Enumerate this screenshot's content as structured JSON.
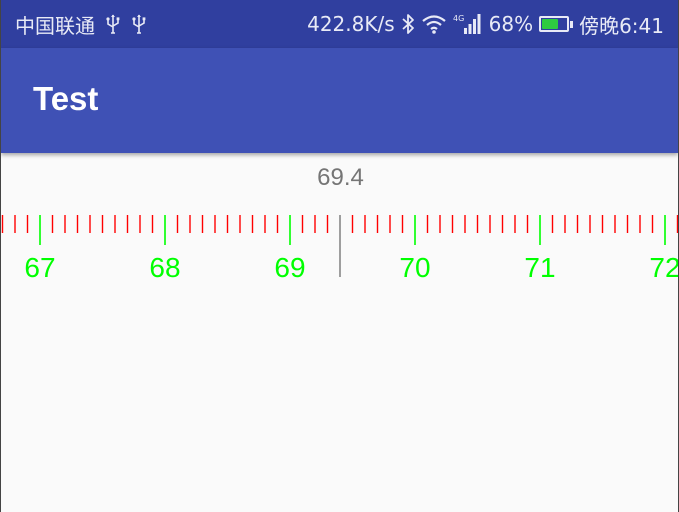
{
  "status_bar": {
    "carrier": "中国联通",
    "usb_icons": [
      "usb-icon",
      "usb-icon"
    ],
    "net_speed": "422.8K/s",
    "network_type": "4G",
    "battery_percent": "68%",
    "battery_level": 0.68,
    "battery_fill_color": "#2ecc40",
    "time": "傍晚6:41"
  },
  "app_bar": {
    "title": "Test",
    "color": "#3f51b5"
  },
  "ruler": {
    "value": "69.4",
    "labels": [
      "67",
      "68",
      "69",
      "70",
      "71",
      "72"
    ],
    "minor_tick_color": "#ff0000",
    "major_tick_color": "#00ff00",
    "indicator_color": "#9e9e9e"
  }
}
